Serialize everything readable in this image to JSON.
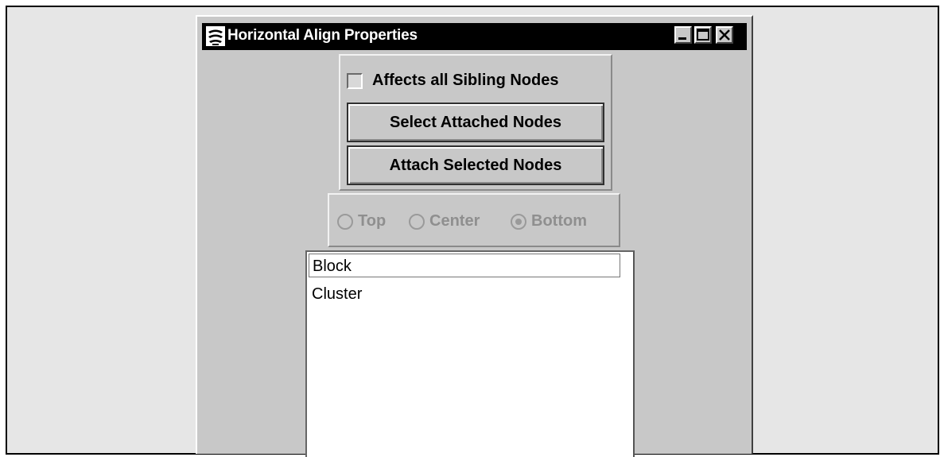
{
  "window": {
    "title": "Horizontal Align Properties",
    "icon": "java-app-icon",
    "controls": [
      "minimize-icon",
      "maximize-icon",
      "close-icon"
    ]
  },
  "options": {
    "affects_siblings_label": "Affects all Sibling Nodes",
    "affects_siblings_checked": false,
    "select_attached_label": "Select Attached Nodes",
    "attach_selected_label": "Attach Selected Nodes"
  },
  "alignment": {
    "enabled": false,
    "options": [
      {
        "label": "Top",
        "selected": false
      },
      {
        "label": "Center",
        "selected": false
      },
      {
        "label": "Bottom",
        "selected": true
      }
    ]
  },
  "node_list": {
    "items": [
      "Block",
      "Cluster"
    ],
    "selected_index": 0
  },
  "colors": {
    "titlebar": "#000000",
    "window_bg": "#c8c8c8",
    "disabled_text": "#8f8f8f"
  }
}
